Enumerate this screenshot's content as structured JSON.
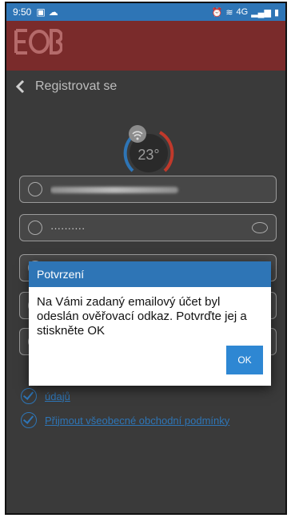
{
  "status_bar": {
    "time": "9:50",
    "right_text": "4G"
  },
  "colors": {
    "accent": "#2e75b6",
    "brand_bar": "#7a2b2b",
    "background": "#3a3a3a"
  },
  "header": {
    "title": "Registrovat se",
    "logo_text": "EOB"
  },
  "thermostat": {
    "temperature": "23°"
  },
  "form": {
    "email_value": "",
    "password_value": "··········"
  },
  "consents": {
    "item1_label": "údajů",
    "item2_label": "Přijmout všeobecné obchodní podmínky"
  },
  "dialog": {
    "title": "Potvrzení",
    "message": "Na Vámi zadaný emailový účet byl odeslán ověřovací odkaz. Potvrďte jej a stiskněte OK",
    "ok_label": "OK"
  }
}
